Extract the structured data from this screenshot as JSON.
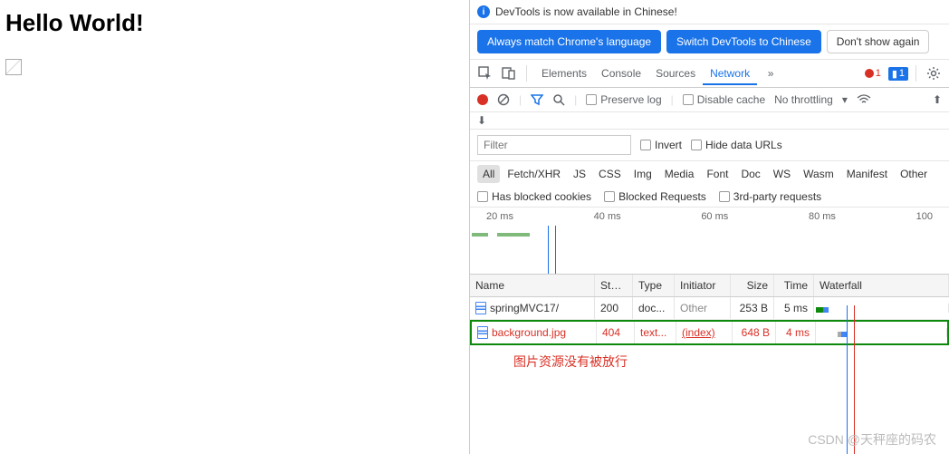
{
  "page": {
    "heading": "Hello World!"
  },
  "infobar": {
    "text": "DevTools is now available in Chinese!"
  },
  "lang_buttons": {
    "match": "Always match Chrome's language",
    "switch": "Switch DevTools to Chinese",
    "dismiss": "Don't show again"
  },
  "tabs": {
    "items": [
      "Elements",
      "Console",
      "Sources",
      "Network"
    ],
    "active": "Network",
    "error_count": "1",
    "issue_count": "1"
  },
  "toolbar": {
    "preserve_log": "Preserve log",
    "disable_cache": "Disable cache",
    "throttling": "No throttling"
  },
  "filterbar": {
    "placeholder": "Filter",
    "invert": "Invert",
    "hide_data_urls": "Hide data URLs"
  },
  "types": [
    "All",
    "Fetch/XHR",
    "JS",
    "CSS",
    "Img",
    "Media",
    "Font",
    "Doc",
    "WS",
    "Wasm",
    "Manifest",
    "Other"
  ],
  "extra_filters": {
    "blocked_cookies": "Has blocked cookies",
    "blocked_requests": "Blocked Requests",
    "third_party": "3rd-party requests"
  },
  "timeline": {
    "ticks": [
      "20 ms",
      "40 ms",
      "60 ms",
      "80 ms",
      "100"
    ]
  },
  "table": {
    "headers": {
      "name": "Name",
      "status": "Stat...",
      "type": "Type",
      "initiator": "Initiator",
      "size": "Size",
      "time": "Time",
      "waterfall": "Waterfall"
    },
    "rows": [
      {
        "name": "springMVC17/",
        "status": "200",
        "type": "doc...",
        "initiator": "Other",
        "size": "253 B",
        "time": "5 ms",
        "error": false
      },
      {
        "name": "background.jpg",
        "status": "404",
        "type": "text...",
        "initiator": "(index)",
        "size": "648 B",
        "time": "4 ms",
        "error": true
      }
    ]
  },
  "annotation": "图片资源没有被放行",
  "watermark": "CSDN @天秤座的码农"
}
